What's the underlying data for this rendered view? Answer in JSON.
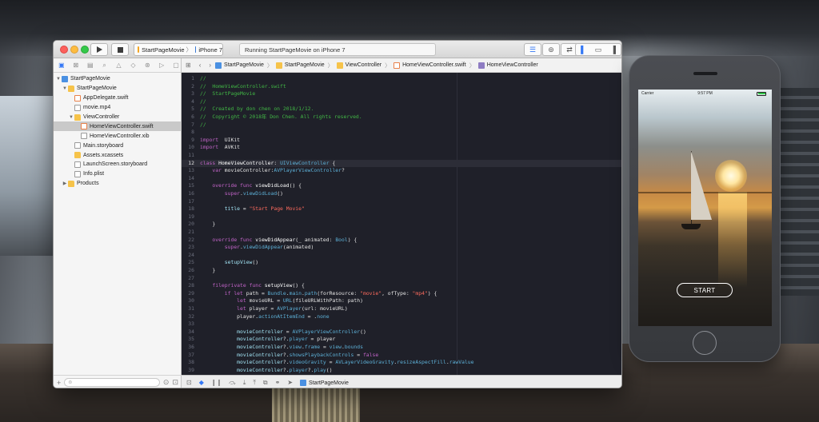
{
  "toolbar": {
    "scheme_app": "StartPageMovie",
    "scheme_device": "iPhone 7",
    "status": "Running StartPageMovie on iPhone 7"
  },
  "navigator": {
    "items": [
      {
        "label": "StartPageMovie",
        "level": 0,
        "kind": "proj",
        "disclosure": "▼"
      },
      {
        "label": "StartPageMovie",
        "level": 1,
        "kind": "folder",
        "disclosure": "▼"
      },
      {
        "label": "AppDelegate.swift",
        "level": 2,
        "kind": "swift",
        "disclosure": ""
      },
      {
        "label": "movie.mp4",
        "level": 2,
        "kind": "file",
        "disclosure": ""
      },
      {
        "label": "ViewController",
        "level": 2,
        "kind": "folder",
        "disclosure": "▼"
      },
      {
        "label": "HomeViewController.swift",
        "level": 3,
        "kind": "swift",
        "disclosure": "",
        "selected": true
      },
      {
        "label": "HomeViewController.xib",
        "level": 3,
        "kind": "file",
        "disclosure": ""
      },
      {
        "label": "Main.storyboard",
        "level": 2,
        "kind": "file",
        "disclosure": ""
      },
      {
        "label": "Assets.xcassets",
        "level": 2,
        "kind": "folder",
        "disclosure": ""
      },
      {
        "label": "LaunchScreen.storyboard",
        "level": 2,
        "kind": "file",
        "disclosure": ""
      },
      {
        "label": "Info.plist",
        "level": 2,
        "kind": "file",
        "disclosure": ""
      },
      {
        "label": "Products",
        "level": 1,
        "kind": "folder",
        "disclosure": "▶"
      }
    ]
  },
  "jumpbar": {
    "crumbs": [
      "StartPageMovie",
      "StartPageMovie",
      "ViewController",
      "HomeViewController.swift",
      "HomeViewController"
    ]
  },
  "editor": {
    "current_line": 12,
    "lines": [
      [
        [
          "c-com",
          "//"
        ]
      ],
      [
        [
          "c-com",
          "//  HomeViewController.swift"
        ]
      ],
      [
        [
          "c-com",
          "//  StartPageMovie"
        ]
      ],
      [
        [
          "c-com",
          "//"
        ]
      ],
      [
        [
          "c-com",
          "//  Created by don chen on 2018/1/12."
        ]
      ],
      [
        [
          "c-com",
          "//  Copyright © 2018年 Don Chen. All rights reserved."
        ]
      ],
      [
        [
          "c-com",
          "//"
        ]
      ],
      [],
      [
        [
          "c-kw",
          "import"
        ],
        [
          "",
          "  UIKit"
        ]
      ],
      [
        [
          "c-kw",
          "import"
        ],
        [
          "",
          "  AVKit"
        ]
      ],
      [],
      [
        [
          "c-kw",
          "class"
        ],
        [
          "c-def",
          " HomeViewController"
        ],
        [
          "",
          ": "
        ],
        [
          "c-type",
          "UIViewController"
        ],
        [
          "",
          " {"
        ]
      ],
      [
        [
          "",
          "    "
        ],
        [
          "c-kw",
          "var"
        ],
        [
          "",
          " movieController:"
        ],
        [
          "c-type",
          "AVPlayerViewController"
        ],
        [
          "",
          "?"
        ]
      ],
      [],
      [
        [
          "",
          "    "
        ],
        [
          "c-kw",
          "override func"
        ],
        [
          "c-def",
          " viewDidLoad"
        ],
        [
          "",
          "() {"
        ]
      ],
      [
        [
          "",
          "        "
        ],
        [
          "c-kw",
          "super"
        ],
        [
          "",
          "."
        ],
        [
          "c-type",
          "viewDidLoad"
        ],
        [
          "",
          "()"
        ]
      ],
      [],
      [
        [
          "",
          "        "
        ],
        [
          "c-id",
          "title"
        ],
        [
          "",
          " = "
        ],
        [
          "c-str",
          "\"Start Page Movie\""
        ]
      ],
      [],
      [
        [
          "",
          "    }"
        ]
      ],
      [],
      [
        [
          "",
          "    "
        ],
        [
          "c-kw",
          "override func"
        ],
        [
          "c-def",
          " viewDidAppear"
        ],
        [
          "",
          "(_ animated: "
        ],
        [
          "c-type",
          "Bool"
        ],
        [
          "",
          ") {"
        ]
      ],
      [
        [
          "",
          "        "
        ],
        [
          "c-kw",
          "super"
        ],
        [
          "",
          "."
        ],
        [
          "c-type",
          "viewDidAppear"
        ],
        [
          "",
          "(animated)"
        ]
      ],
      [],
      [
        [
          "",
          "        "
        ],
        [
          "c-id",
          "setupView"
        ],
        [
          "",
          "()"
        ]
      ],
      [
        [
          "",
          "    }"
        ]
      ],
      [],
      [
        [
          "",
          "    "
        ],
        [
          "c-kw",
          "fileprivate func"
        ],
        [
          "c-def",
          " setupView"
        ],
        [
          "",
          "() {"
        ]
      ],
      [
        [
          "",
          "        "
        ],
        [
          "c-kw",
          "if let"
        ],
        [
          "",
          " path = "
        ],
        [
          "c-type",
          "Bundle"
        ],
        [
          "",
          "."
        ],
        [
          "c-type",
          "main"
        ],
        [
          "",
          "."
        ],
        [
          "c-type",
          "path"
        ],
        [
          "",
          "(forResource: "
        ],
        [
          "c-str",
          "\"movie\""
        ],
        [
          "",
          ", ofType: "
        ],
        [
          "c-str",
          "\"mp4\""
        ],
        [
          "",
          ") {"
        ]
      ],
      [
        [
          "",
          "            "
        ],
        [
          "c-kw",
          "let"
        ],
        [
          "",
          " movieURL = "
        ],
        [
          "c-type",
          "URL"
        ],
        [
          "",
          "(fileURLWithPath: path)"
        ]
      ],
      [
        [
          "",
          "            "
        ],
        [
          "c-kw",
          "let"
        ],
        [
          "",
          " player = "
        ],
        [
          "c-type",
          "AVPlayer"
        ],
        [
          "",
          "(url: movieURL)"
        ]
      ],
      [
        [
          "",
          "            player."
        ],
        [
          "c-type",
          "actionAtItemEnd"
        ],
        [
          "",
          " = ."
        ],
        [
          "c-type",
          "none"
        ]
      ],
      [],
      [
        [
          "",
          "            "
        ],
        [
          "c-id",
          "movieController"
        ],
        [
          "",
          " = "
        ],
        [
          "c-type",
          "AVPlayerViewController"
        ],
        [
          "",
          "()"
        ]
      ],
      [
        [
          "",
          "            "
        ],
        [
          "c-id",
          "movieController"
        ],
        [
          "",
          "?."
        ],
        [
          "c-type",
          "player"
        ],
        [
          "",
          " = player"
        ]
      ],
      [
        [
          "",
          "            "
        ],
        [
          "c-id",
          "movieController"
        ],
        [
          "",
          "?."
        ],
        [
          "c-type",
          "view"
        ],
        [
          "",
          "."
        ],
        [
          "c-type",
          "frame"
        ],
        [
          "",
          " = "
        ],
        [
          "c-type",
          "view"
        ],
        [
          "",
          "."
        ],
        [
          "c-type",
          "bounds"
        ]
      ],
      [
        [
          "",
          "            "
        ],
        [
          "c-id",
          "movieController"
        ],
        [
          "",
          "?."
        ],
        [
          "c-type",
          "showsPlaybackControls"
        ],
        [
          "",
          " = "
        ],
        [
          "c-kw",
          "false"
        ]
      ],
      [
        [
          "",
          "            "
        ],
        [
          "c-id",
          "movieController"
        ],
        [
          "",
          "?."
        ],
        [
          "c-type",
          "videoGravity"
        ],
        [
          "",
          " = "
        ],
        [
          "c-type",
          "AVLayerVideoGravity"
        ],
        [
          "",
          "."
        ],
        [
          "c-type",
          "resizeAspectFill"
        ],
        [
          "",
          "."
        ],
        [
          "c-type",
          "rawValue"
        ]
      ],
      [
        [
          "",
          "            "
        ],
        [
          "c-id",
          "movieController"
        ],
        [
          "",
          "?."
        ],
        [
          "c-type",
          "player"
        ],
        [
          "",
          "?."
        ],
        [
          "c-type",
          "play"
        ],
        [
          "",
          "()"
        ]
      ],
      [
        [
          "",
          "            "
        ],
        [
          "c-id",
          "movieController"
        ],
        [
          "",
          "?."
        ],
        [
          "c-type",
          "view"
        ],
        [
          "",
          "."
        ],
        [
          "c-type",
          "alpha"
        ],
        [
          "",
          " = "
        ],
        [
          "c-num",
          "0"
        ]
      ]
    ]
  },
  "debugbar": {
    "target": "StartPageMovie"
  },
  "simulator": {
    "carrier": "Carrier",
    "time": "9:57 PM",
    "start_label": "START"
  }
}
